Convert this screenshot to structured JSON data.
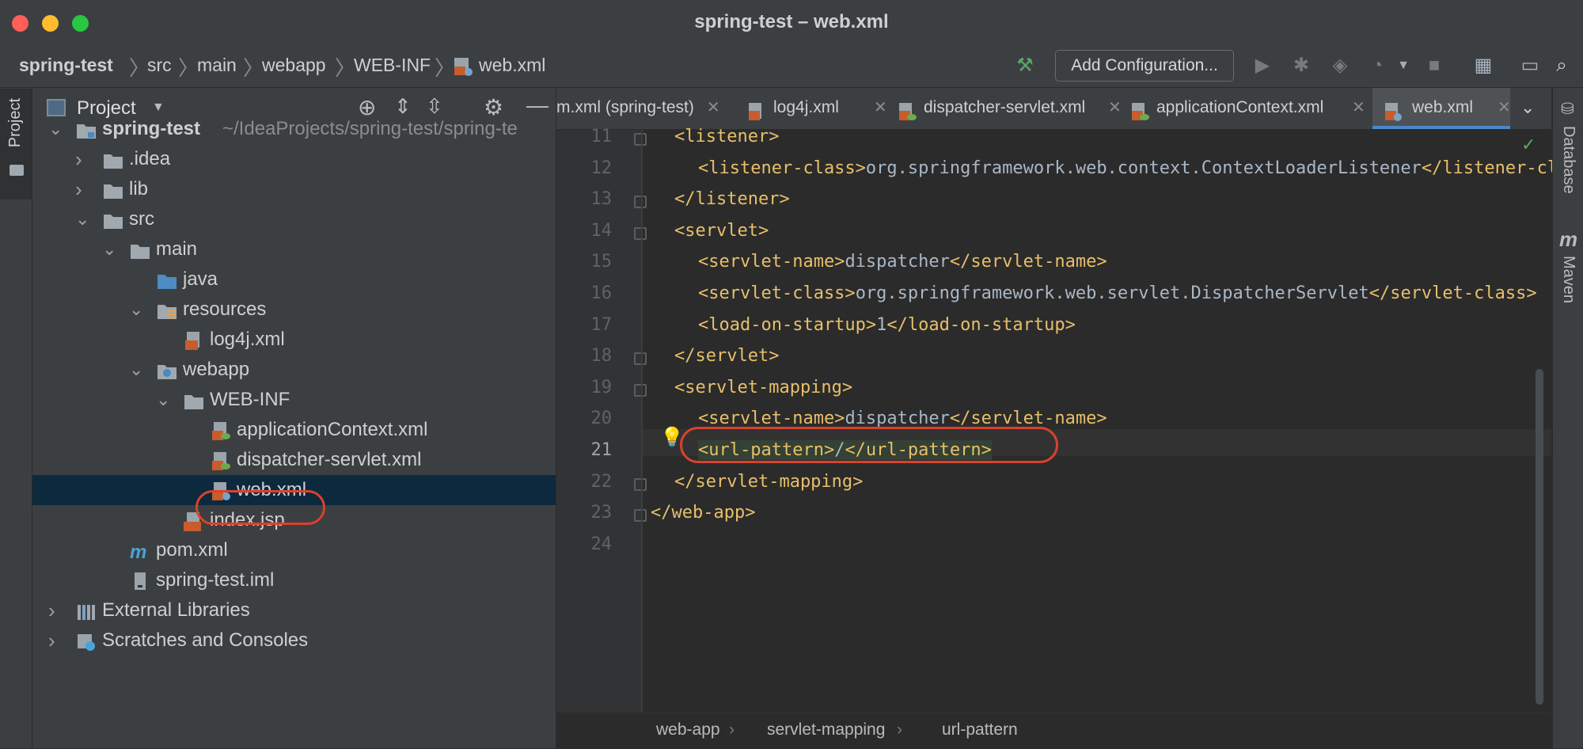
{
  "window": {
    "title": "spring-test – web.xml"
  },
  "navbar": {
    "breadcrumbs": [
      "spring-test",
      "src",
      "main",
      "webapp",
      "WEB-INF",
      "web.xml"
    ],
    "add_configuration": "Add Configuration..."
  },
  "left_strip": {
    "project_tab": "Project"
  },
  "project_panel": {
    "title": "Project",
    "tree": [
      {
        "label": "spring-test",
        "path_hint": "~/IdeaProjects/spring-test/spring-te",
        "level": 0,
        "expanded": true,
        "icon": "module-folder-icon"
      },
      {
        "label": ".idea",
        "level": 1,
        "expanded": false,
        "icon": "folder-icon"
      },
      {
        "label": "lib",
        "level": 1,
        "expanded": false,
        "icon": "folder-icon"
      },
      {
        "label": "src",
        "level": 1,
        "expanded": true,
        "icon": "folder-icon"
      },
      {
        "label": "main",
        "level": 2,
        "expanded": true,
        "icon": "folder-icon"
      },
      {
        "label": "java",
        "level": 3,
        "icon": "source-folder-icon"
      },
      {
        "label": "resources",
        "level": 3,
        "expanded": true,
        "icon": "resources-folder-icon"
      },
      {
        "label": "log4j.xml",
        "level": 4,
        "icon": "xml-file-icon"
      },
      {
        "label": "webapp",
        "level": 3,
        "expanded": true,
        "icon": "web-folder-icon"
      },
      {
        "label": "WEB-INF",
        "level": 4,
        "expanded": true,
        "icon": "folder-icon"
      },
      {
        "label": "applicationContext.xml",
        "level": 5,
        "icon": "spring-xml-icon"
      },
      {
        "label": "dispatcher-servlet.xml",
        "level": 5,
        "icon": "spring-xml-icon"
      },
      {
        "label": "web.xml",
        "level": 5,
        "icon": "web-xml-icon",
        "selected": true
      },
      {
        "label": "index.jsp",
        "level": 4,
        "icon": "jsp-file-icon"
      },
      {
        "label": "pom.xml",
        "level": 2,
        "icon": "maven-icon"
      },
      {
        "label": "spring-test.iml",
        "level": 2,
        "icon": "iml-file-icon"
      },
      {
        "label": "External Libraries",
        "level": 0,
        "expanded": false,
        "icon": "libraries-icon"
      },
      {
        "label": "Scratches and Consoles",
        "level": 0,
        "expanded": false,
        "icon": "scratches-icon"
      }
    ]
  },
  "editor": {
    "tabs": [
      {
        "label": "m.xml (spring-test)",
        "active": false
      },
      {
        "label": "log4j.xml",
        "active": false
      },
      {
        "label": "dispatcher-servlet.xml",
        "active": false
      },
      {
        "label": "applicationContext.xml",
        "active": false
      },
      {
        "label": "web.xml",
        "active": true
      }
    ],
    "current_line": 21,
    "lines": [
      {
        "n": "11",
        "text": "<listener>"
      },
      {
        "n": "12",
        "text": "<listener-class>org.springframework.web.context.ContextLoaderListener</listener-class>"
      },
      {
        "n": "13",
        "text": "</listener>"
      },
      {
        "n": "14",
        "text": "<servlet>"
      },
      {
        "n": "15",
        "text": "<servlet-name>dispatcher</servlet-name>"
      },
      {
        "n": "16",
        "text": "<servlet-class>org.springframework.web.servlet.DispatcherServlet</servlet-class>"
      },
      {
        "n": "17",
        "text": "<load-on-startup>1</load-on-startup>"
      },
      {
        "n": "18",
        "text": "</servlet>"
      },
      {
        "n": "19",
        "text": "<servlet-mapping>"
      },
      {
        "n": "20",
        "text": "<servlet-name>dispatcher</servlet-name>"
      },
      {
        "n": "21",
        "text": "<url-pattern>/</url-pattern>"
      },
      {
        "n": "22",
        "text": "</servlet-mapping>"
      },
      {
        "n": "23",
        "text": "</web-app>"
      },
      {
        "n": "24",
        "text": ""
      }
    ],
    "breadcrumbs": [
      "web-app",
      "servlet-mapping",
      "url-pattern"
    ]
  },
  "right_strip": {
    "database_tab": "Database",
    "maven_tab": "Maven"
  },
  "colors": {
    "tag": "#e8bf6a",
    "text": "#a9b7c6",
    "selection": "#0d293e",
    "annotation_red": "#d9422c",
    "active_tab_underline": "#4a88c7"
  }
}
